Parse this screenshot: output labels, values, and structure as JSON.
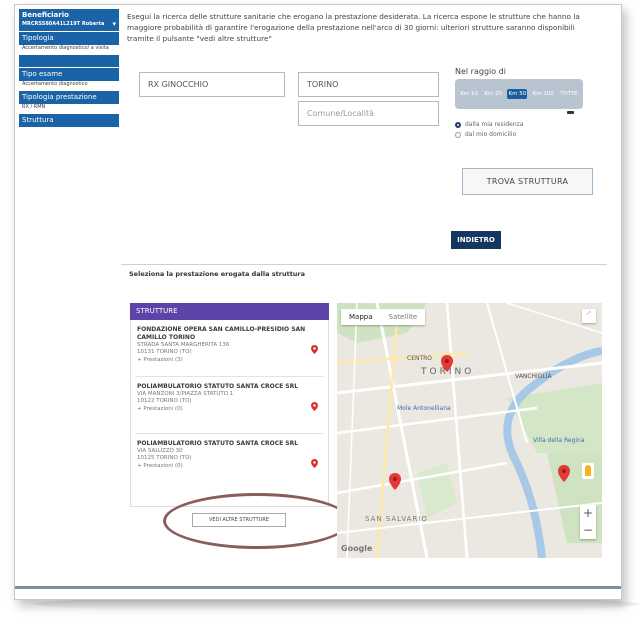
{
  "sidebar": {
    "beneficiario_label": "Beneficiario",
    "beneficiario_code": "MRCRSS80A41L219T Roberta",
    "tipologia_label": "Tipologia",
    "tipologia_value": "Accertamento diagnostico/ a visita",
    "tipo_esame_label": "Tipo esame",
    "tipo_esame_value": "Accertamento diagnostico",
    "tipologia_prestazione_label": "Tipologia prestazione",
    "tipologia_prestazione_value": "RX / RMN",
    "struttura_label": "Struttura"
  },
  "intro_text": "Esegui la ricerca delle strutture sanitarie che erogano la prestazione desiderata. La ricerca espone le strutture che hanno la maggiore probabilità di garantire l'erogazione della prestazione nell'arco di 30 giorni: ulteriori strutture saranno disponibili tramite il pulsante \"vedi altre strutture\"",
  "search": {
    "prestazione_value": "RX GINOCCHIO",
    "citta_value": "TORINO",
    "comune_placeholder": "Comune/Località"
  },
  "radius": {
    "label": "Nel raggio di",
    "options": [
      "Km 10",
      "Km 20",
      "Km 50",
      "Km 100",
      "TUTTE"
    ],
    "selected_index": 2,
    "radio_1": "dalla mia residenza",
    "radio_2": "dal mio domicilio"
  },
  "buttons": {
    "trova": "TROVA STRUTTURA",
    "indietro": "INDIETRO",
    "vedi_altre": "VEDI ALTRE STRUTTURE"
  },
  "section_title": "Seleziona la prestazione erogata dalla struttura",
  "results": {
    "header": "STRUTTURE",
    "items": [
      {
        "name": "FONDAZIONE OPERA SAN CAMILLO-PRESIDIO SAN CAMILLO TORINO",
        "address": "STRADA SANTA MARGHERITA 136",
        "city": "10131 TORINO (TO)",
        "prestazioni": "Prestazioni (3)"
      },
      {
        "name": "POLIAMBULATORIO STATUTO SANTA CROCE SRL",
        "address": "VIA MANZONI 3/PIAZZA STATUTO 1",
        "city": "10122 TORINO (TO)",
        "prestazioni": "Prestazioni (0)"
      },
      {
        "name": "POLIAMBULATORIO STATUTO SANTA CROCE SRL",
        "address": "VIA SALUZZO 30",
        "city": "10125 TORINO (TO)",
        "prestazioni": "Prestazioni (0)"
      }
    ]
  },
  "map": {
    "tab_map": "Mappa",
    "tab_satellite": "Satellite",
    "labels": {
      "torino": "TORINO",
      "centro": "CENTRO",
      "vanchiglia": "VANCHIGLIA",
      "san_salvario": "SAN SALVARIO",
      "mole": "Mole Antonelliana",
      "villa": "Villa della Regina",
      "google": "Google"
    }
  },
  "colors": {
    "sidebar_blue": "#1a63a6",
    "results_header": "#5b43a8",
    "indietro_bg": "#15365f",
    "radius_selected": "#1b5ea0"
  }
}
